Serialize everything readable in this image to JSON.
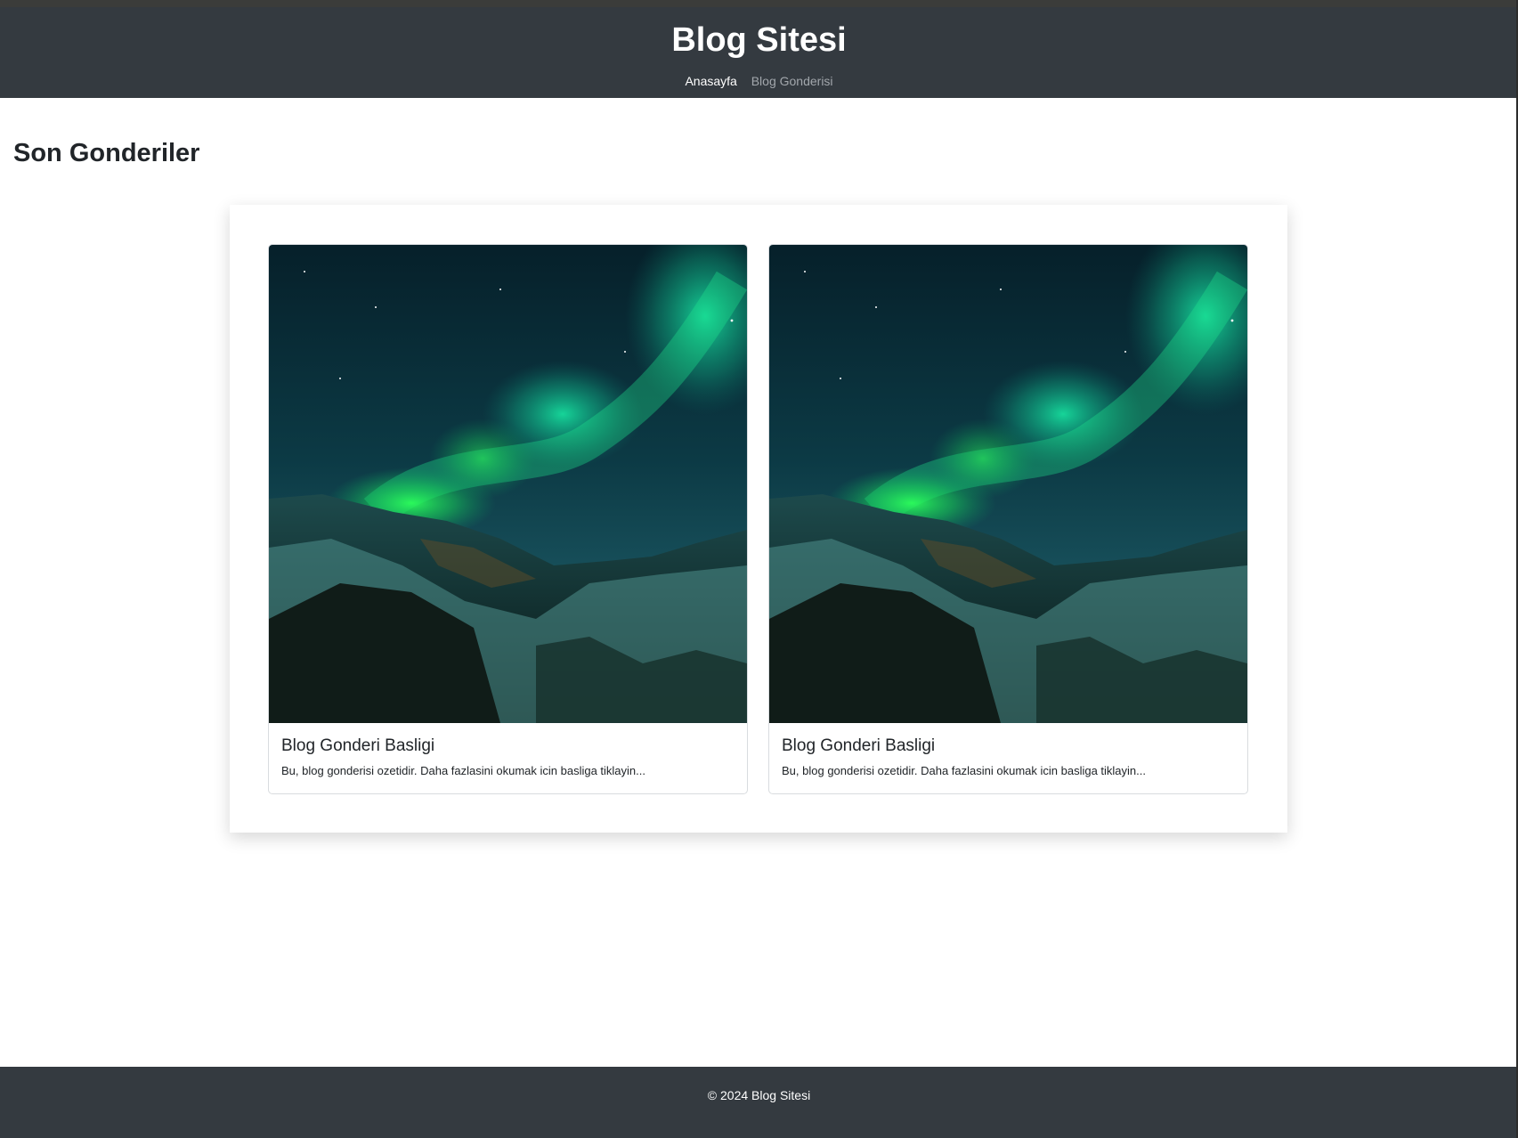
{
  "header": {
    "title": "Blog Sitesi",
    "nav": [
      {
        "label": "Anasayfa",
        "active": true
      },
      {
        "label": "Blog Gonderisi",
        "active": false
      }
    ]
  },
  "main": {
    "section_title": "Son Gonderiler",
    "posts": [
      {
        "title": "Blog Gonderi Basligi",
        "excerpt": "Bu, blog gonderisi ozetidir. Daha fazlasini okumak icin basliga tiklayin...",
        "image": "aurora-landscape-image"
      },
      {
        "title": "Blog Gonderi Basligi",
        "excerpt": "Bu, blog gonderisi ozetidir. Daha fazlasini okumak icin basliga tiklayin...",
        "image": "aurora-landscape-image"
      }
    ]
  },
  "footer": {
    "text": "© 2024 Blog Sitesi"
  },
  "colors": {
    "header_bg": "#343a40",
    "footer_bg": "#343a40",
    "nav_active": "#ffffff",
    "nav_muted": "#a2a7ac",
    "aurora_green": "#1ee87a"
  }
}
